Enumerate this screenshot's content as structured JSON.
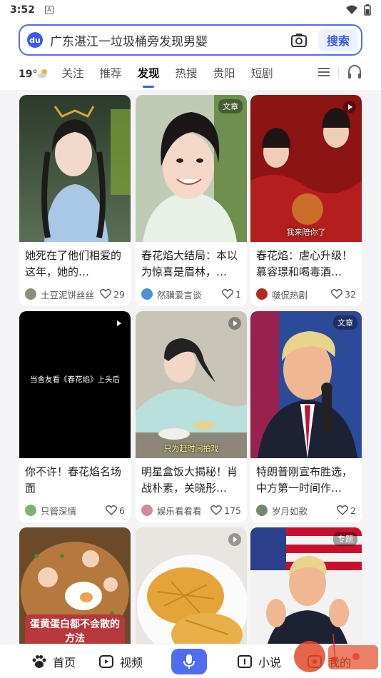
{
  "status": {
    "time": "3:52",
    "app_badge": "A"
  },
  "search": {
    "query": "广东湛江一垃圾桶旁发现男婴",
    "button": "搜索",
    "logo_text": "du"
  },
  "weather": {
    "temp": "19",
    "unit": "°"
  },
  "tabs": [
    {
      "label": "关注",
      "active": false
    },
    {
      "label": "推荐",
      "active": false
    },
    {
      "label": "发现",
      "active": true
    },
    {
      "label": "热搜",
      "active": false
    },
    {
      "label": "贵阳",
      "active": false
    },
    {
      "label": "短剧",
      "active": false
    }
  ],
  "cards": [
    {
      "title": "她死在了他们相爱的这年，她的…",
      "author": "土豆泥饼丝丝",
      "likes": "29",
      "badge": "",
      "overlay": ""
    },
    {
      "title": "春花焰大结局：本以为惊喜是眉林，…",
      "author": "然骥爱言谈",
      "likes": "1",
      "badge": "文章",
      "overlay": ""
    },
    {
      "title": "春花焰：虐心升级！慕容璟和喝毒酒…",
      "author": "啵侃热剧",
      "likes": "32",
      "badge": "",
      "overlay": "我来陪你了"
    },
    {
      "title": "你不许！春花焰名场面",
      "author": "只管深情",
      "likes": "6",
      "badge": "",
      "overlay": "当舍友看《春花焰》上头后"
    },
    {
      "title": "明星盒饭大揭秘！肖战朴素，关晓彤…",
      "author": "娱乐看看看",
      "likes": "175",
      "badge": "",
      "overlay": "只为赶时间拍戏"
    },
    {
      "title": "特朗普刚宣布胜选，中方第一时间作…",
      "author": "岁月如歌",
      "likes": "2",
      "badge": "文章",
      "overlay": ""
    },
    {
      "title": "",
      "author": "",
      "likes": "",
      "badge": "",
      "overlay": "蛋黄蛋白都不会散的方法"
    },
    {
      "title": "",
      "author": "",
      "likes": "",
      "badge": "",
      "overlay": ""
    },
    {
      "title": "",
      "author": "",
      "likes": "",
      "badge": "专题",
      "overlay": ""
    }
  ],
  "bottom_nav": [
    {
      "label": "首页"
    },
    {
      "label": "视频"
    },
    {
      "label": "小说"
    },
    {
      "label": "我的"
    }
  ],
  "colors": {
    "accent": "#4e6ef2",
    "background": "#f4f4f6"
  }
}
